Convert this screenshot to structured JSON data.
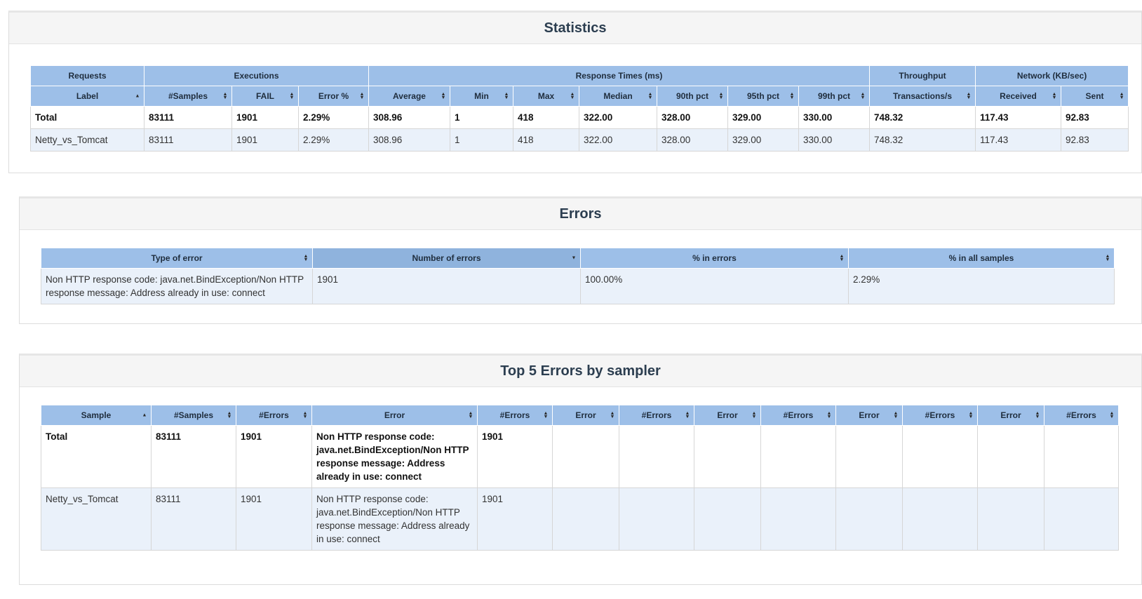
{
  "statistics": {
    "title": "Statistics",
    "group_headers": [
      "Requests",
      "Executions",
      "Response Times (ms)",
      "Throughput",
      "Network (KB/sec)"
    ],
    "columns": [
      "Label",
      "#Samples",
      "FAIL",
      "Error %",
      "Average",
      "Min",
      "Max",
      "Median",
      "90th pct",
      "95th pct",
      "99th pct",
      "Transactions/s",
      "Received",
      "Sent"
    ],
    "rows": [
      [
        "Total",
        "83111",
        "1901",
        "2.29%",
        "308.96",
        "1",
        "418",
        "322.00",
        "328.00",
        "329.00",
        "330.00",
        "748.32",
        "117.43",
        "92.83"
      ],
      [
        "Netty_vs_Tomcat",
        "83111",
        "1901",
        "2.29%",
        "308.96",
        "1",
        "418",
        "322.00",
        "328.00",
        "329.00",
        "330.00",
        "748.32",
        "117.43",
        "92.83"
      ]
    ]
  },
  "errors": {
    "title": "Errors",
    "columns": [
      "Type of error",
      "Number of errors",
      "% in errors",
      "% in all samples"
    ],
    "rows": [
      [
        "Non HTTP response code: java.net.BindException/Non HTTP response message: Address already in use: connect",
        "1901",
        "100.00%",
        "2.29%"
      ]
    ]
  },
  "top5": {
    "title": "Top 5 Errors by sampler",
    "columns": [
      "Sample",
      "#Samples",
      "#Errors",
      "Error",
      "#Errors",
      "Error",
      "#Errors",
      "Error",
      "#Errors",
      "Error",
      "#Errors",
      "Error",
      "#Errors"
    ],
    "rows": [
      [
        "Total",
        "83111",
        "1901",
        "Non HTTP response code: java.net.BindException/Non HTTP response message: Address already in use: connect",
        "1901",
        "",
        "",
        "",
        "",
        "",
        "",
        "",
        ""
      ],
      [
        "Netty_vs_Tomcat",
        "83111",
        "1901",
        "Non HTTP response code: java.net.BindException/Non HTTP response message: Address already in use: connect",
        "1901",
        "",
        "",
        "",
        "",
        "",
        "",
        "",
        ""
      ]
    ]
  }
}
